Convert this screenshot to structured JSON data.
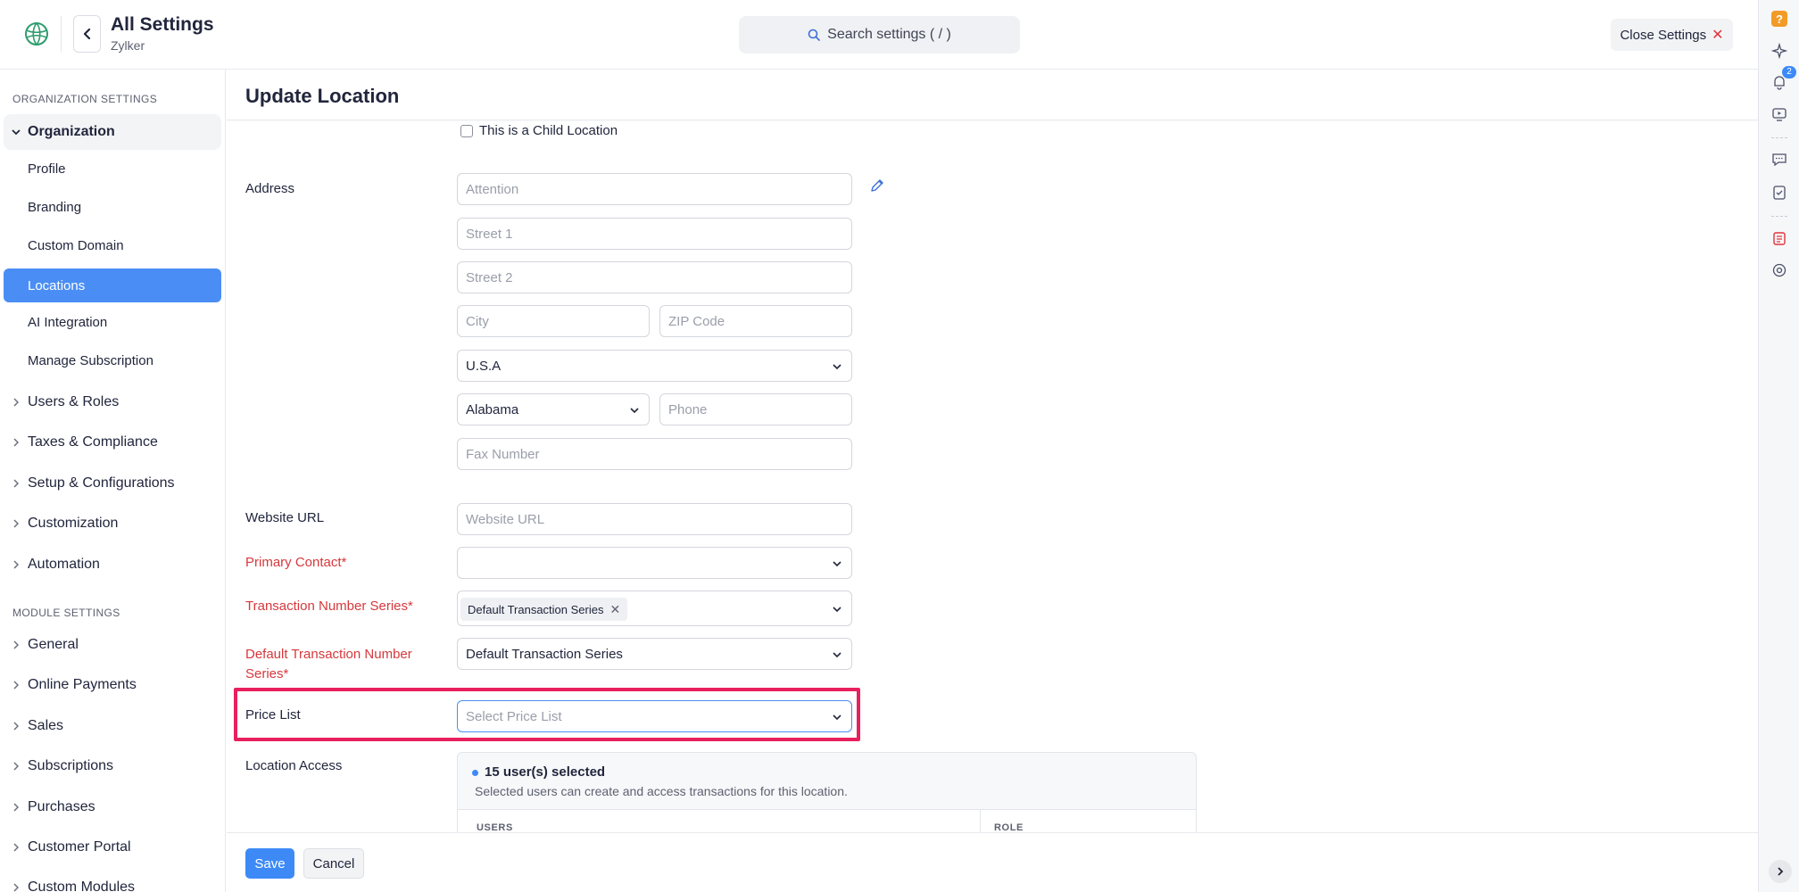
{
  "header": {
    "title": "All Settings",
    "org": "Zylker",
    "search_placeholder": "Search settings ( / )",
    "close_label": "Close Settings",
    "close_symbol": "✕"
  },
  "rail": {
    "help_symbol": "?",
    "notification_count": "2"
  },
  "sidebar": {
    "org_section": "ORGANIZATION SETTINGS",
    "org_group": "Organization",
    "org_items": [
      "Profile",
      "Branding",
      "Custom Domain",
      "Locations",
      "AI Integration",
      "Manage Subscription"
    ],
    "active_item": "Locations",
    "groups": [
      "Users & Roles",
      "Taxes & Compliance",
      "Setup & Configurations",
      "Customization",
      "Automation"
    ],
    "module_section": "MODULE SETTINGS",
    "module_groups": [
      "General",
      "Online Payments",
      "Sales",
      "Subscriptions",
      "Purchases",
      "Customer Portal",
      "Custom Modules"
    ]
  },
  "page": {
    "title": "Update Location",
    "child_location_label": "This is a Child Location",
    "address_label": "Address",
    "attention_placeholder": "Attention",
    "street1_placeholder": "Street 1",
    "street2_placeholder": "Street 2",
    "city_placeholder": "City",
    "zip_placeholder": "ZIP Code",
    "country_value": "U.S.A",
    "state_value": "Alabama",
    "phone_placeholder": "Phone",
    "fax_placeholder": "Fax Number",
    "website_label": "Website URL",
    "website_placeholder": "Website URL",
    "primary_contact_label": "Primary Contact*",
    "primary_contact_value": "",
    "txn_series_label": "Transaction Number Series*",
    "txn_series_tag": "Default Transaction Series",
    "txn_series_tag_remove": "✕",
    "default_txn_label_line1": "Default Transaction Number",
    "default_txn_label_line2": "Series*",
    "default_txn_value": "Default Transaction Series",
    "price_list_label": "Price List",
    "price_list_placeholder": "Select Price List",
    "location_access_label": "Location Access",
    "access_count": "15 user(s) selected",
    "access_desc": "Selected users can create and access transactions for this location.",
    "col_users": "USERS",
    "col_role": "ROLE"
  },
  "footer": {
    "save_label": "Save",
    "cancel_label": "Cancel"
  },
  "colors": {
    "accent": "#3d8af7",
    "active_nav": "#4a8ef5",
    "required": "#d6383c",
    "highlight": "#e8205e",
    "help_badge": "#f29b27"
  },
  "icons": [
    "logo-icon",
    "chevron-left-icon",
    "search-icon",
    "close-icon",
    "help-icon",
    "sparkle-icon",
    "bell-icon",
    "video-icon",
    "chat-icon",
    "checklist-icon",
    "report-icon",
    "settings-gear-icon",
    "chevron-right-icon",
    "pencil-icon",
    "chevron-down-icon"
  ]
}
